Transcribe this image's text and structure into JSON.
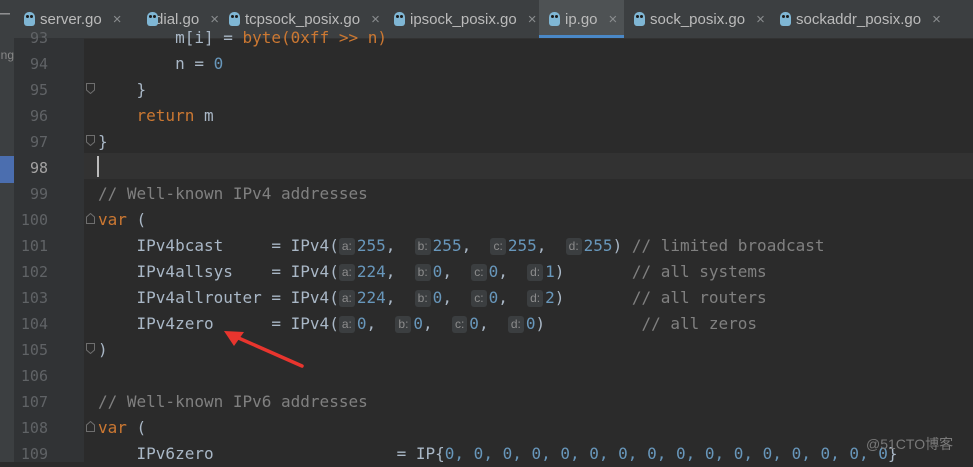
{
  "tabs": [
    {
      "label": "server.go",
      "active": false
    },
    {
      "label": "dial.go",
      "active": false
    },
    {
      "label": "tcpsock_posix.go",
      "active": false
    },
    {
      "label": "ipsock_posix.go",
      "active": false
    },
    {
      "label": "ip.go",
      "active": true
    },
    {
      "label": "sock_posix.go",
      "active": false
    },
    {
      "label": "sockaddr_posix.go",
      "active": false
    }
  ],
  "tab_close_glyph": "×",
  "left_strip_text": "ing",
  "line_numbers": [
    "93",
    "94",
    "95",
    "96",
    "97",
    "98",
    "99",
    "100",
    "101",
    "102",
    "103",
    "104",
    "105",
    "106",
    "107",
    "108",
    "109"
  ],
  "current_line": "98",
  "code": {
    "l93_a": "        m[i] = ",
    "l93_b": "byte(0xff >> n)",
    "l94_a": "        n = ",
    "l94_b": "0",
    "l95": "    }",
    "l96_kw": "return",
    "l96_b": " m",
    "l97": "}",
    "l99": "// Well-known IPv4 addresses",
    "l100_kw": "var",
    "l100_b": " (",
    "l101_name": "    IPv4bcast     = IPv4(",
    "l101_vals": [
      "255",
      "255",
      "255",
      "255"
    ],
    "l101_comment": "// limited broadcast",
    "l102_name": "    IPv4allsys    = IPv4(",
    "l102_vals": [
      "224",
      "0",
      "0",
      "1"
    ],
    "l102_comment": "// all systems",
    "l103_name": "    IPv4allrouter = IPv4(",
    "l103_vals": [
      "224",
      "0",
      "0",
      "2"
    ],
    "l103_comment": "// all routers",
    "l104_name": "    IPv4zero      = IPv4(",
    "l104_vals": [
      "0",
      "0",
      "0",
      "0"
    ],
    "l104_comment": "// all zeros",
    "l105": ")",
    "l107": "// Well-known IPv6 addresses",
    "l108_kw": "var",
    "l108_b": " (",
    "l109_name": "    IPv6zero                   = IP{",
    "l109_vals": "0, 0, 0, 0, 0, 0, 0, 0, 0, 0, 0, 0, 0, 0, 0, 0",
    "l109_end": "}"
  },
  "param_hints": [
    "a:",
    "b:",
    "c:",
    "d:"
  ],
  "syntax_colors": {
    "keyword": "#cc7832",
    "number": "#6897bb",
    "comment": "#808080",
    "text": "#a9b7c6",
    "background": "#2b2b2b"
  },
  "annotation_arrow_color": "#e8352e",
  "watermark": "@51CTO博客"
}
